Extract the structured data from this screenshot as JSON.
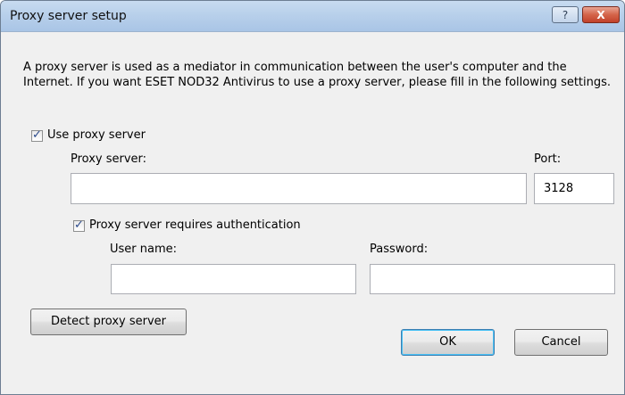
{
  "window": {
    "title": "Proxy server setup",
    "help_label": "?",
    "close_label": "X"
  },
  "description": "A proxy server is used as a mediator in communication between the user's computer and the Internet. If you want ESET NOD32 Antivirus to use a proxy server, please fill in the following settings.",
  "use_proxy": {
    "label": "Use proxy server",
    "checked": true
  },
  "proxy_server": {
    "label": "Proxy server:",
    "value": ""
  },
  "port": {
    "label": "Port:",
    "value": "3128"
  },
  "auth": {
    "label": "Proxy server requires authentication",
    "checked": true
  },
  "username": {
    "label": "User name:",
    "value": ""
  },
  "password": {
    "label": "Password:",
    "value": ""
  },
  "buttons": {
    "detect": "Detect proxy server",
    "ok": "OK",
    "cancel": "Cancel"
  },
  "icons": {
    "check": "checkmark-icon",
    "help": "help-icon",
    "close": "close-icon"
  },
  "colors": {
    "titlebar": "#b7cfea",
    "close_button": "#c1412a",
    "dialog_bg": "#f0f0f0",
    "checkmark": "#2b4a8b"
  }
}
